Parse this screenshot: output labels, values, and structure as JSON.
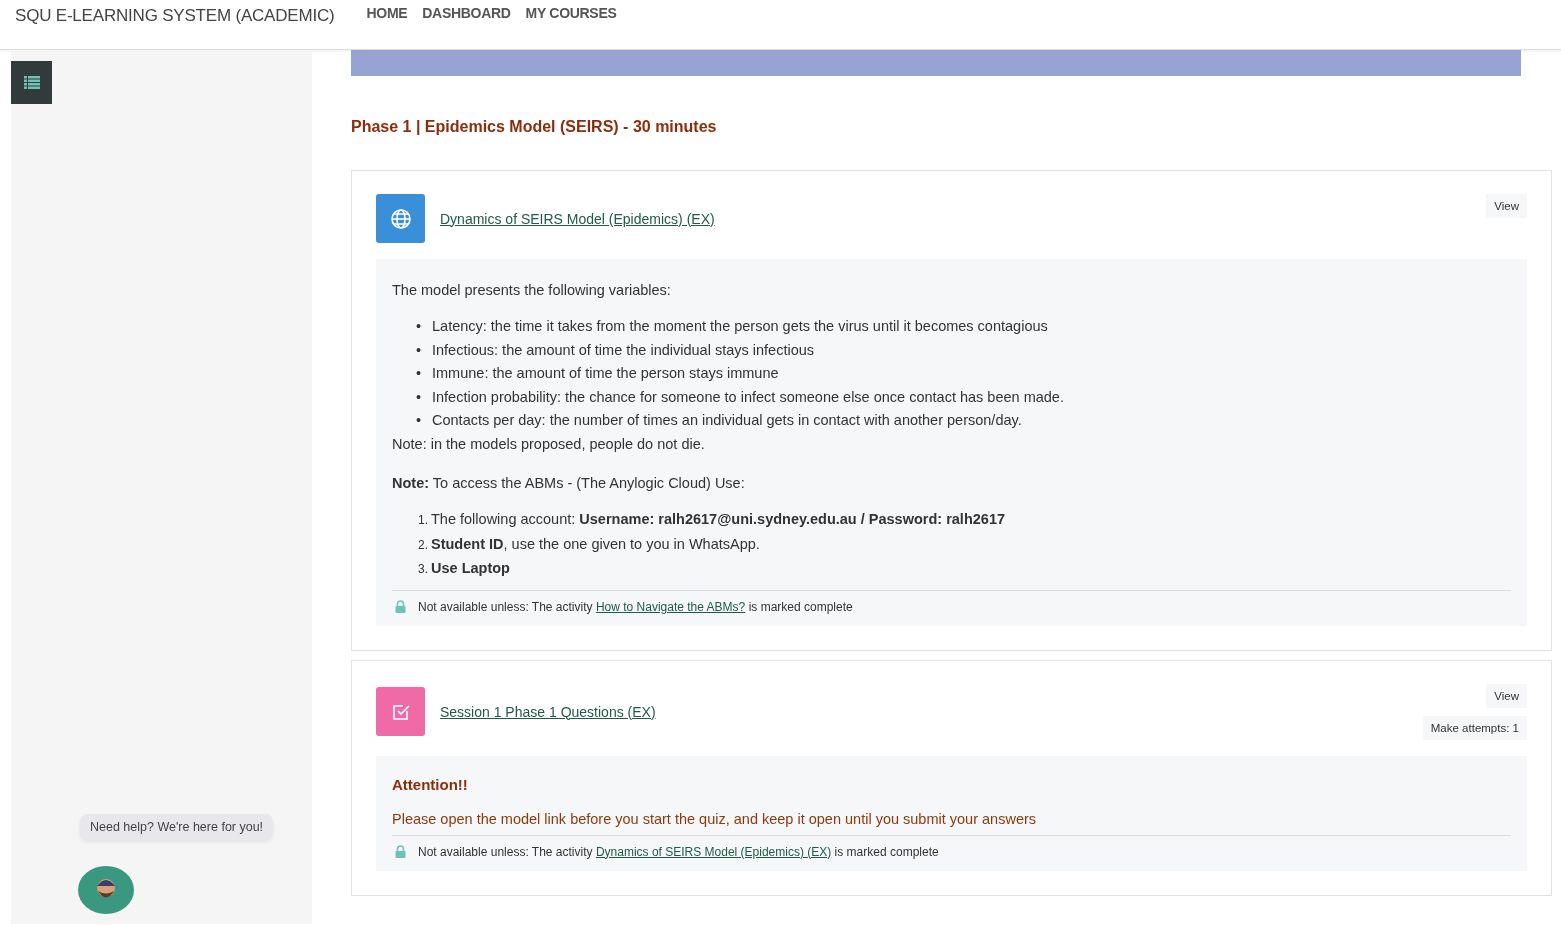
{
  "header": {
    "site_name": "SQU E-LEARNING SYSTEM (ACADEMIC)",
    "nav": [
      "HOME",
      "DASHBOARD",
      "MY COURSES"
    ]
  },
  "sidebar": {
    "help_bubble": "Need help? We're here for you!"
  },
  "section_title": "Phase 1 |  Epidemics Model (SEIRS) - 30 minutes",
  "activities": [
    {
      "kind": "url",
      "title": "Dynamics of SEIRS Model (Epidemics) (EX)",
      "buttons": [
        "View"
      ],
      "content": [
        {
          "kind": "paragraph",
          "text": "The model presents the following variables:"
        },
        {
          "kind": "bullets",
          "items": [
            {
              "marker": "•",
              "text": "Latency: the time it takes from the moment the person gets the virus until it becomes contagious"
            },
            {
              "marker": "•",
              "text": "Infectious: the amount of time the individual stays infectious"
            },
            {
              "marker": "•",
              "text": "Immune: the amount of time the person stays immune"
            },
            {
              "marker": "•",
              "text": "Infection probability: the chance for someone to infect someone else once contact has been made."
            },
            {
              "marker": "•",
              "text": "Contacts per day: the number of times an individual gets in contact with another person/day."
            }
          ]
        },
        {
          "kind": "tight",
          "text": "Note: in the models proposed, people do not die."
        },
        {
          "kind": "paragraph",
          "text": "**Note:** To access the ABMs - (The Anylogic Cloud) Use:"
        },
        {
          "kind": "ordered",
          "items": [
            {
              "marker": "1.",
              "text": "The following account: **Username: ralh2617@uni.sydney.edu.au / Password: ralh2617**"
            },
            {
              "marker": "2.",
              "text": "**Student ID**, use the one given to you in WhatsApp."
            },
            {
              "marker": "3.",
              "text": "**Use Laptop**"
            }
          ]
        }
      ],
      "restriction": {
        "prefix": "Not available unless: The activity",
        "link": "How to Navigate the ABMs?",
        "suffix": "is marked complete"
      }
    },
    {
      "kind": "quiz",
      "title": "Session 1 Phase 1 Questions (EX)",
      "buttons": [
        "View",
        "Make attempts: 1"
      ],
      "content": [
        {
          "kind": "heading",
          "text": "Attention!!"
        },
        {
          "kind": "alert",
          "text": "Please open the model link before you start the quiz, and keep it open until you submit your answers"
        }
      ],
      "restriction": {
        "prefix": "Not available unless: The activity",
        "link": "Dynamics of SEIRS Model (Epidemics) (EX)",
        "suffix": "is marked complete"
      }
    }
  ]
}
